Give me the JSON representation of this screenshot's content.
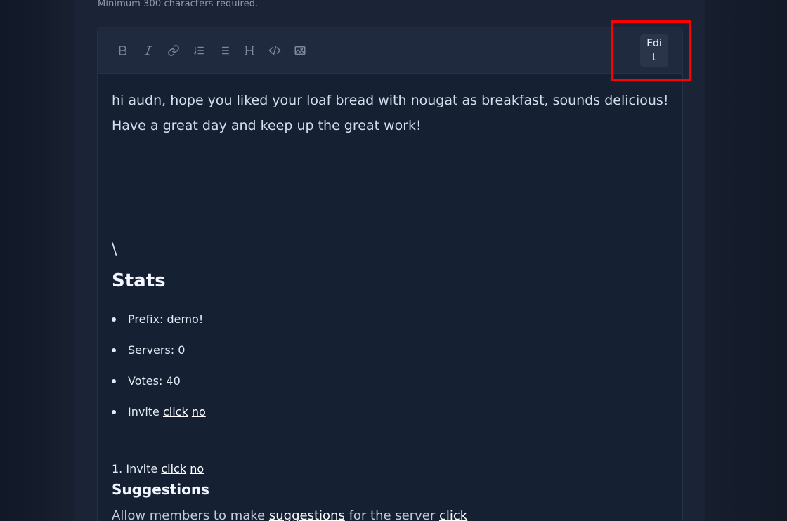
{
  "hint": "Minimum 300 characters required.",
  "toolbar": {
    "tools": [
      {
        "icon": "bold-icon"
      },
      {
        "icon": "italic-icon"
      },
      {
        "icon": "link-icon"
      },
      {
        "icon": "ordered-list-icon"
      },
      {
        "icon": "unordered-list-icon"
      },
      {
        "icon": "heading-icon"
      },
      {
        "icon": "code-icon"
      },
      {
        "icon": "image-icon"
      }
    ],
    "edit_label": "Edi\nt"
  },
  "content": {
    "line1": "hi audn, hope you liked your loaf bread with nougat as breakfast, sounds delicious!",
    "line2": "Have a great day and keep up the great work!",
    "backslash": "\\",
    "stats_title": "Stats",
    "stats": [
      {
        "label": "Prefix: demo!"
      },
      {
        "label": "Servers: 0"
      },
      {
        "label": "Votes: 40"
      }
    ],
    "invite_label": "Invite",
    "invite_link1": "click",
    "invite_link2": "no",
    "ol_invite_prefix": "1. Invite",
    "ol_invite_link1": "click",
    "ol_invite_link2": "no",
    "suggestions_title": "Suggestions",
    "suggestions_text1": "Allow members to make",
    "suggestions_link": "suggestions",
    "suggestions_text2": "for the server",
    "suggestions_click": "click"
  },
  "colors": {
    "background": "#1b2437",
    "editor": "#152033",
    "toolbar": "#1f2a3e",
    "highlight": "#ff0000"
  }
}
